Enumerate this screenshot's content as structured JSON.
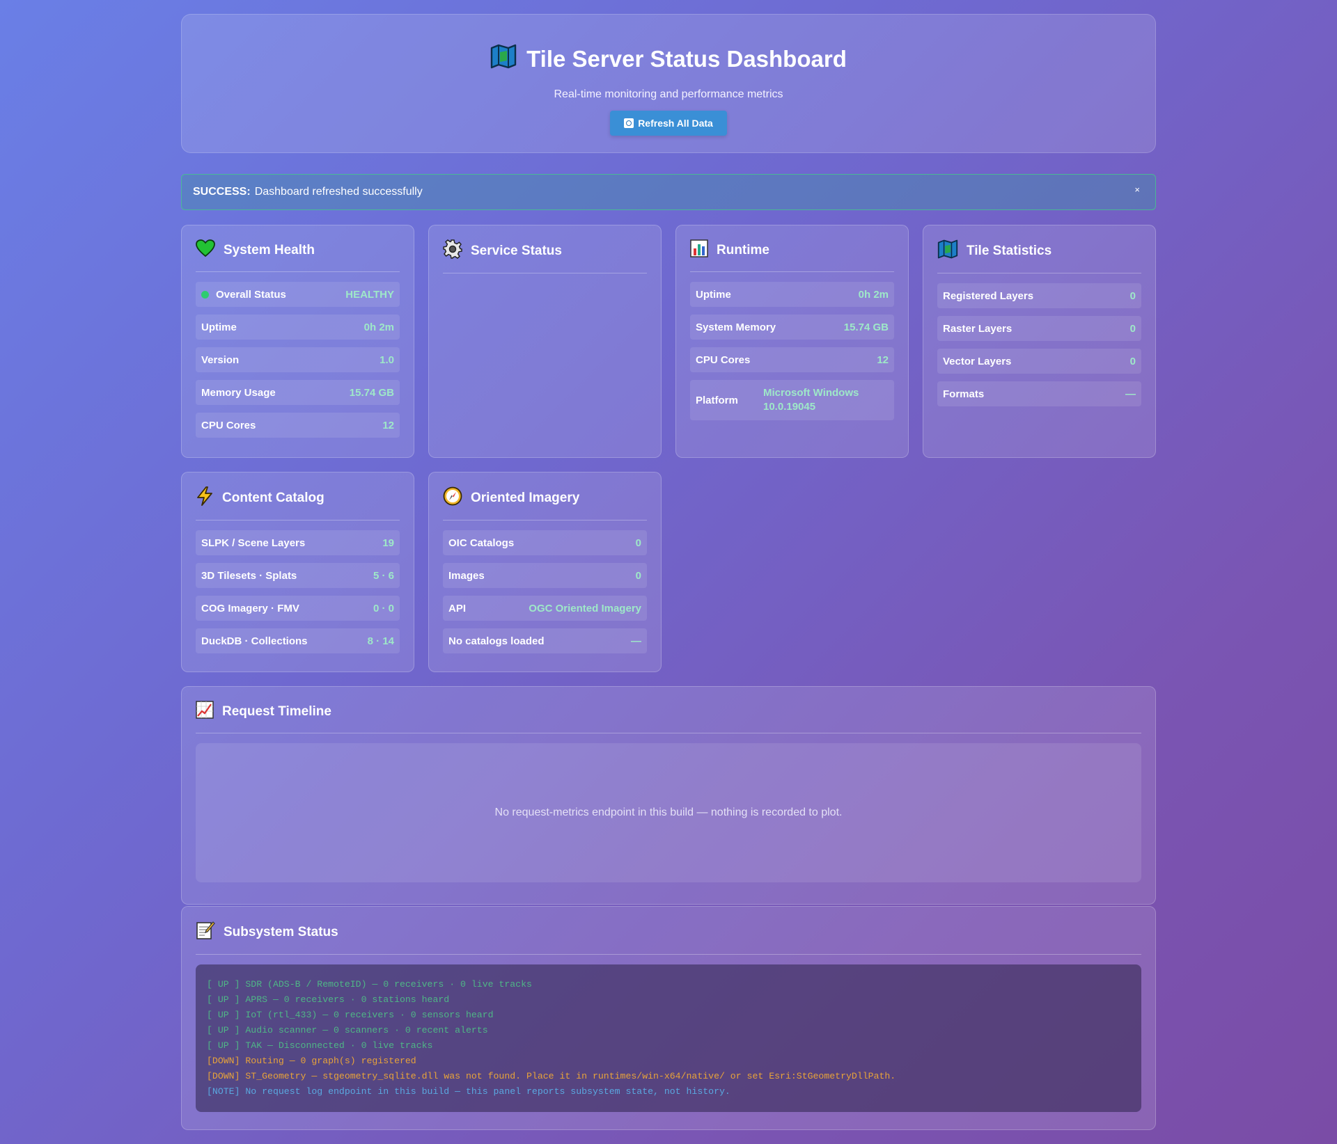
{
  "header": {
    "title": "Tile Server Status Dashboard",
    "subtitle": "Real-time monitoring and performance metrics",
    "refresh_label": "Refresh All Data"
  },
  "alert": {
    "label": "SUCCESS:",
    "message": "Dashboard refreshed successfully",
    "close": "×"
  },
  "system_health": {
    "title": "System Health",
    "rows": [
      {
        "label": "Overall Status",
        "value": "HEALTHY"
      },
      {
        "label": "Uptime",
        "value": "0h 2m"
      },
      {
        "label": "Version",
        "value": "1.0"
      },
      {
        "label": "Memory Usage",
        "value": "15.74 GB"
      },
      {
        "label": "CPU Cores",
        "value": "12"
      }
    ]
  },
  "service_status": {
    "title": "Service Status"
  },
  "runtime": {
    "title": "Runtime",
    "rows": [
      {
        "label": "Uptime",
        "value": "0h 2m"
      },
      {
        "label": "System Memory",
        "value": "15.74 GB"
      },
      {
        "label": "CPU Cores",
        "value": "12"
      },
      {
        "label": "Platform",
        "value": "Microsoft Windows 10.0.19045"
      }
    ]
  },
  "tile_statistics": {
    "title": "Tile Statistics",
    "rows": [
      {
        "label": "Registered Layers",
        "value": "0"
      },
      {
        "label": "Raster Layers",
        "value": "0"
      },
      {
        "label": "Vector Layers",
        "value": "0"
      },
      {
        "label": "Formats",
        "value": "—"
      }
    ]
  },
  "content_catalog": {
    "title": "Content Catalog",
    "rows": [
      {
        "label": "SLPK / Scene Layers",
        "value": "19"
      },
      {
        "label": "3D Tilesets · Splats",
        "value": "5 · 6"
      },
      {
        "label": "COG Imagery · FMV",
        "value": "0 · 0"
      },
      {
        "label": "DuckDB · Collections",
        "value": "8 · 14"
      }
    ]
  },
  "oriented_imagery": {
    "title": "Oriented Imagery",
    "rows": [
      {
        "label": "OIC Catalogs",
        "value": "0"
      },
      {
        "label": "Images",
        "value": "0"
      },
      {
        "label": "API",
        "value": "OGC Oriented Imagery"
      },
      {
        "label": "No catalogs loaded",
        "value": "—"
      }
    ]
  },
  "request_timeline": {
    "title": "Request Timeline",
    "empty_message": "No request-metrics endpoint in this build — nothing is recorded to plot."
  },
  "subsystem_status": {
    "title": "Subsystem Status",
    "lines": [
      {
        "kind": "up",
        "text": "[ UP ] SDR (ADS-B / RemoteID) — 0 receivers · 0 live tracks"
      },
      {
        "kind": "up",
        "text": "[ UP ] APRS — 0 receivers · 0 stations heard"
      },
      {
        "kind": "up",
        "text": "[ UP ] IoT (rtl_433) — 0 receivers · 0 sensors heard"
      },
      {
        "kind": "up",
        "text": "[ UP ] Audio scanner — 0 scanners · 0 recent alerts"
      },
      {
        "kind": "up",
        "text": "[ UP ] TAK — Disconnected · 0 live tracks"
      },
      {
        "kind": "down",
        "text": "[DOWN] Routing — 0 graph(s) registered"
      },
      {
        "kind": "down",
        "text": "[DOWN] ST_Geometry — stgeometry_sqlite.dll was not found. Place it in runtimes/win-x64/native/ or set Esri:StGeometryDllPath."
      },
      {
        "kind": "note",
        "text": "[NOTE] No request log endpoint in this build — this panel reports subsystem state, not history."
      }
    ]
  },
  "colors": {
    "accent_value": "#9ee8c8",
    "status_up": "#4fb686",
    "status_down": "#e8a33a",
    "status_note": "#5aa8e0",
    "healthy_dot": "#2ecc71"
  },
  "icons": {
    "header": "folded-map-icon",
    "system_health": "green-heart-icon",
    "service_status": "gear-icon",
    "runtime": "bar-chart-icon",
    "tile_statistics": "folded-map-icon",
    "content_catalog": "lightning-icon",
    "oriented_imagery": "compass-icon",
    "request_timeline": "line-chart-icon",
    "subsystem_status": "memo-icon"
  }
}
